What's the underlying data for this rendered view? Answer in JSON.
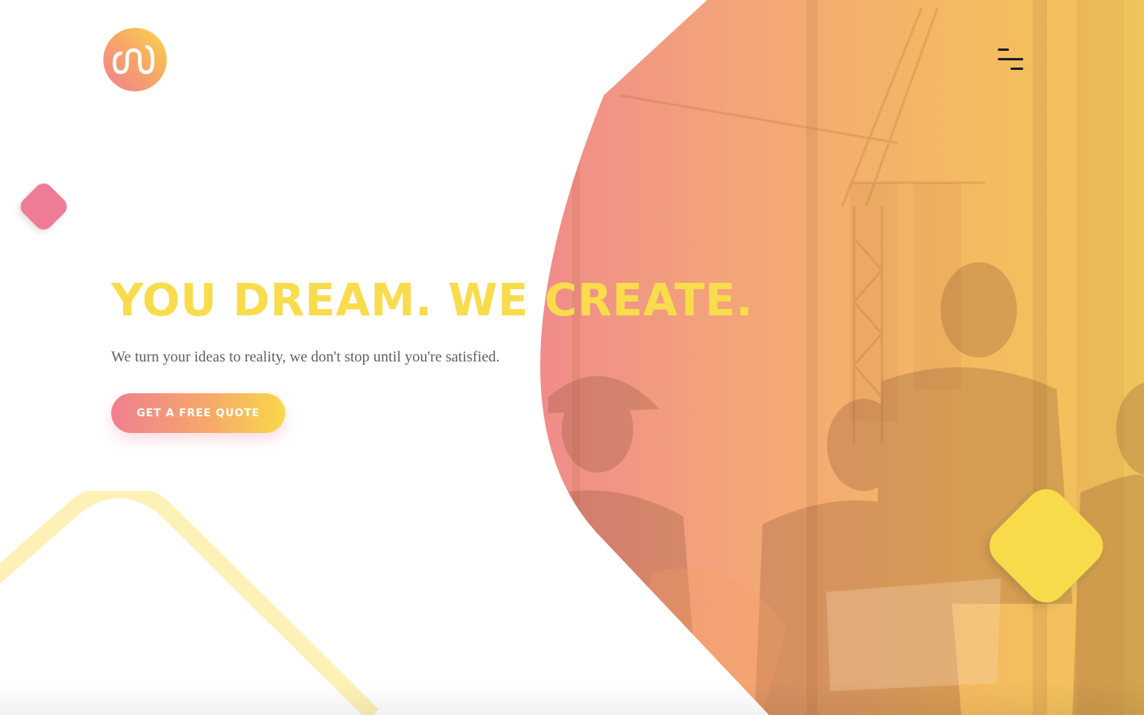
{
  "brand": {
    "logo_icon": "infinity-loops-logo",
    "colors": {
      "pink": "#ef7f91",
      "orange": "#f6a86a",
      "yellow": "#f9dc4c",
      "text": "#5f5f66",
      "menu": "#1f1f2a"
    }
  },
  "header": {
    "menu_icon": "hamburger-menu-icon"
  },
  "hero": {
    "title": "YOU DREAM. WE CREATE.",
    "subtitle": "We turn your ideas to reality, we don't stop until you're satisfied.",
    "cta_label": "GET A FREE QUOTE",
    "image_subject": "construction-team-meeting-photo"
  },
  "decorations": {
    "pink_shape": "rounded-diamond",
    "yellow_shape": "rounded-diamond",
    "outline_shape": "rounded-diamond-outline"
  }
}
